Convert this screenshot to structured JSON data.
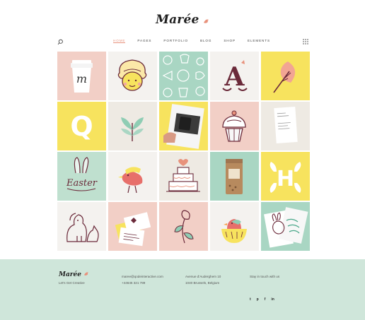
{
  "brand": {
    "name": "Marée",
    "tagline": "Let's Get Creative"
  },
  "nav": {
    "items": [
      {
        "label": "HOME",
        "active": true
      },
      {
        "label": "PAGES",
        "active": false
      },
      {
        "label": "PORTFOLIO",
        "active": false
      },
      {
        "label": "BLOG",
        "active": false
      },
      {
        "label": "SHOP",
        "active": false
      },
      {
        "label": "ELEMENTS",
        "active": false
      }
    ],
    "icons": [
      "search-icon",
      "grid-icon"
    ]
  },
  "gallery": {
    "tiles": [
      {
        "name": "coffee-cup",
        "bg": "#f2cfc6",
        "letter": "m"
      },
      {
        "name": "girl-face",
        "bg": "#f4f2ef"
      },
      {
        "name": "pattern-sweets",
        "bg": "#a9d6c3"
      },
      {
        "name": "letter-a",
        "bg": "#f4f2ef",
        "letter": "A"
      },
      {
        "name": "leaf",
        "bg": "#f7e35e"
      },
      {
        "name": "letter-q",
        "bg": "#f7e35e",
        "letter": "Q"
      },
      {
        "name": "plant",
        "bg": "#eeeae3"
      },
      {
        "name": "photo-mug",
        "bg": "#f7e35e"
      },
      {
        "name": "cupcake",
        "bg": "#f2cfc6"
      },
      {
        "name": "business-card",
        "bg": "#eeeae3"
      },
      {
        "name": "easter-bunny",
        "bg": "#bfe0cf",
        "text": "Easter"
      },
      {
        "name": "bird-wave",
        "bg": "#f4f2ef"
      },
      {
        "name": "wedding-cake",
        "bg": "#eeeae3"
      },
      {
        "name": "coffee-bag",
        "bg": "#a9d6c3"
      },
      {
        "name": "letter-h",
        "bg": "#f7e35e",
        "letter": "H"
      },
      {
        "name": "dog-cat",
        "bg": "#f4f2ef"
      },
      {
        "name": "cards-stack",
        "bg": "#f2cfc6"
      },
      {
        "name": "flower-line",
        "bg": "#f2cfc6"
      },
      {
        "name": "bird-cup",
        "bg": "#f4f2ef"
      },
      {
        "name": "bunny-card",
        "bg": "#a9d6c3"
      }
    ]
  },
  "footer": {
    "email": "maree@qodeinteractive.com",
    "phone": "+44645 321 789",
    "address_line1": "Avenue d'Auderghem 10",
    "address_line2": "1040 Brussels, Belgium",
    "social_title": "Stay in touch with us",
    "social": [
      "twitter",
      "pinterest",
      "facebook",
      "linkedin"
    ],
    "social_glyphs": [
      "t",
      "p",
      "f",
      "in"
    ]
  },
  "colors": {
    "accent": "#e8927c",
    "footer_bg": "#cfe6da",
    "pink": "#f2cfc6",
    "yellow": "#f7e35e",
    "mint": "#a9d6c3"
  }
}
